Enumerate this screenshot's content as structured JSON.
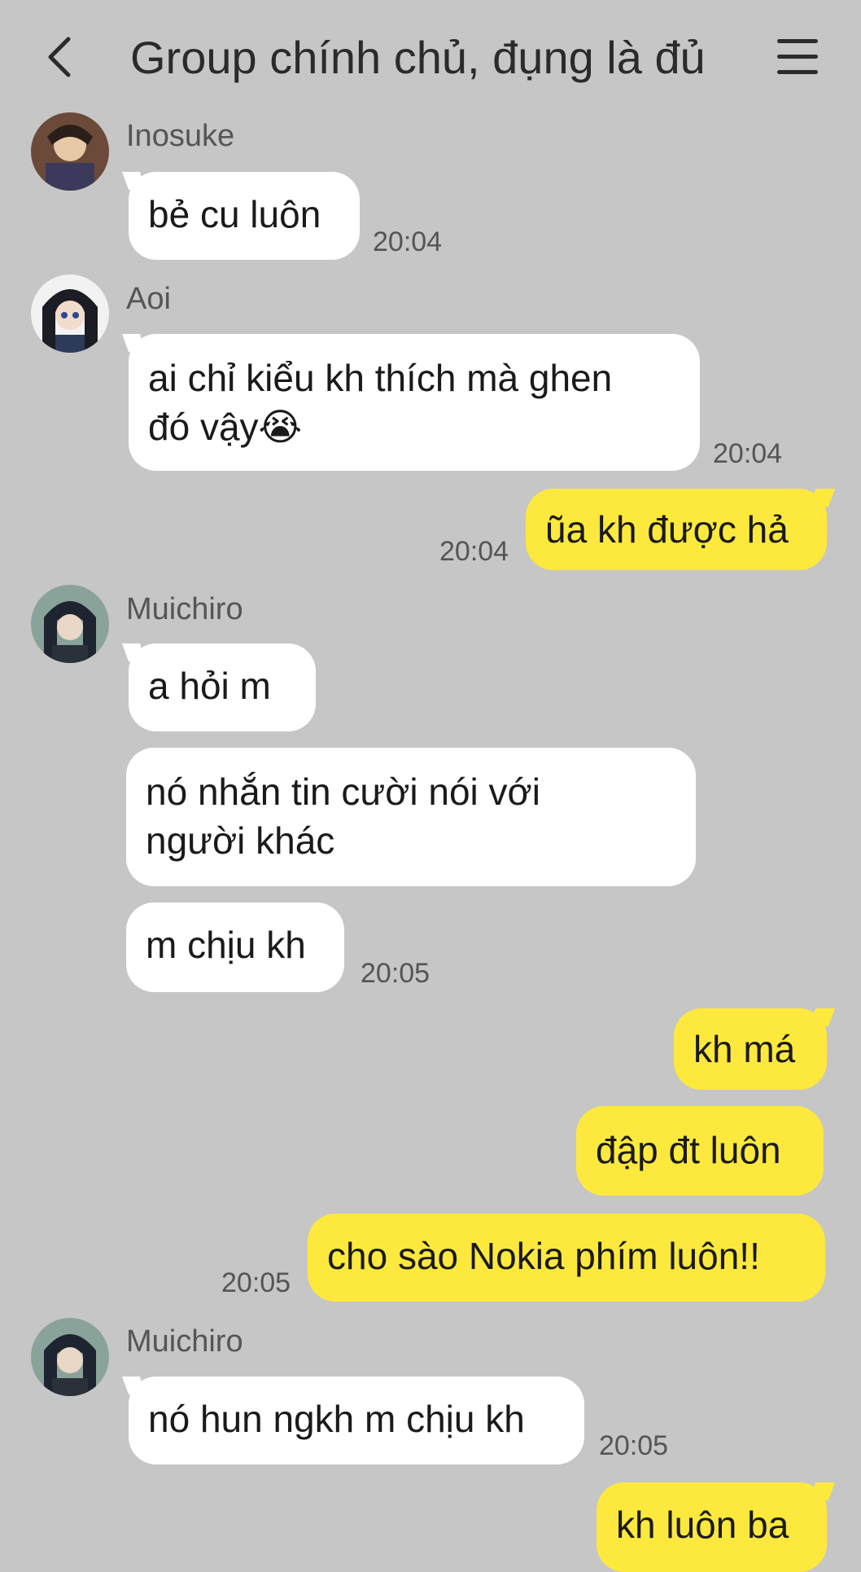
{
  "header": {
    "title": "Group chính chủ, đụng là đủ",
    "back_icon": "back-chevron-icon",
    "menu_icon": "hamburger-menu-icon"
  },
  "colors": {
    "background": "#c6c6c6",
    "incoming_bubble": "#ffffff",
    "outgoing_bubble": "#fde93d"
  },
  "messages": [
    {
      "sender": "Inosuke",
      "text": "bẻ cu luôn",
      "time": "20:04"
    },
    {
      "sender": "Aoi",
      "text": "ai chỉ kiểu kh thích mà ghen\nđó vậy😭",
      "time": "20:04"
    },
    {
      "text": "ũa kh được hả",
      "time": "20:04"
    },
    {
      "sender": "Muichiro",
      "text": "a hỏi m"
    },
    {
      "text": "nó nhắn tin cười nói với\nngười khác"
    },
    {
      "text": "m chịu kh",
      "time": "20:05"
    },
    {
      "text": "kh má"
    },
    {
      "text": "đập đt luôn"
    },
    {
      "text": "cho sào Nokia phím luôn!!",
      "time": "20:05"
    },
    {
      "sender": "Muichiro",
      "text": "nó hun ngkh m chịu kh",
      "time": "20:05"
    },
    {
      "text": "kh luôn ba"
    }
  ]
}
